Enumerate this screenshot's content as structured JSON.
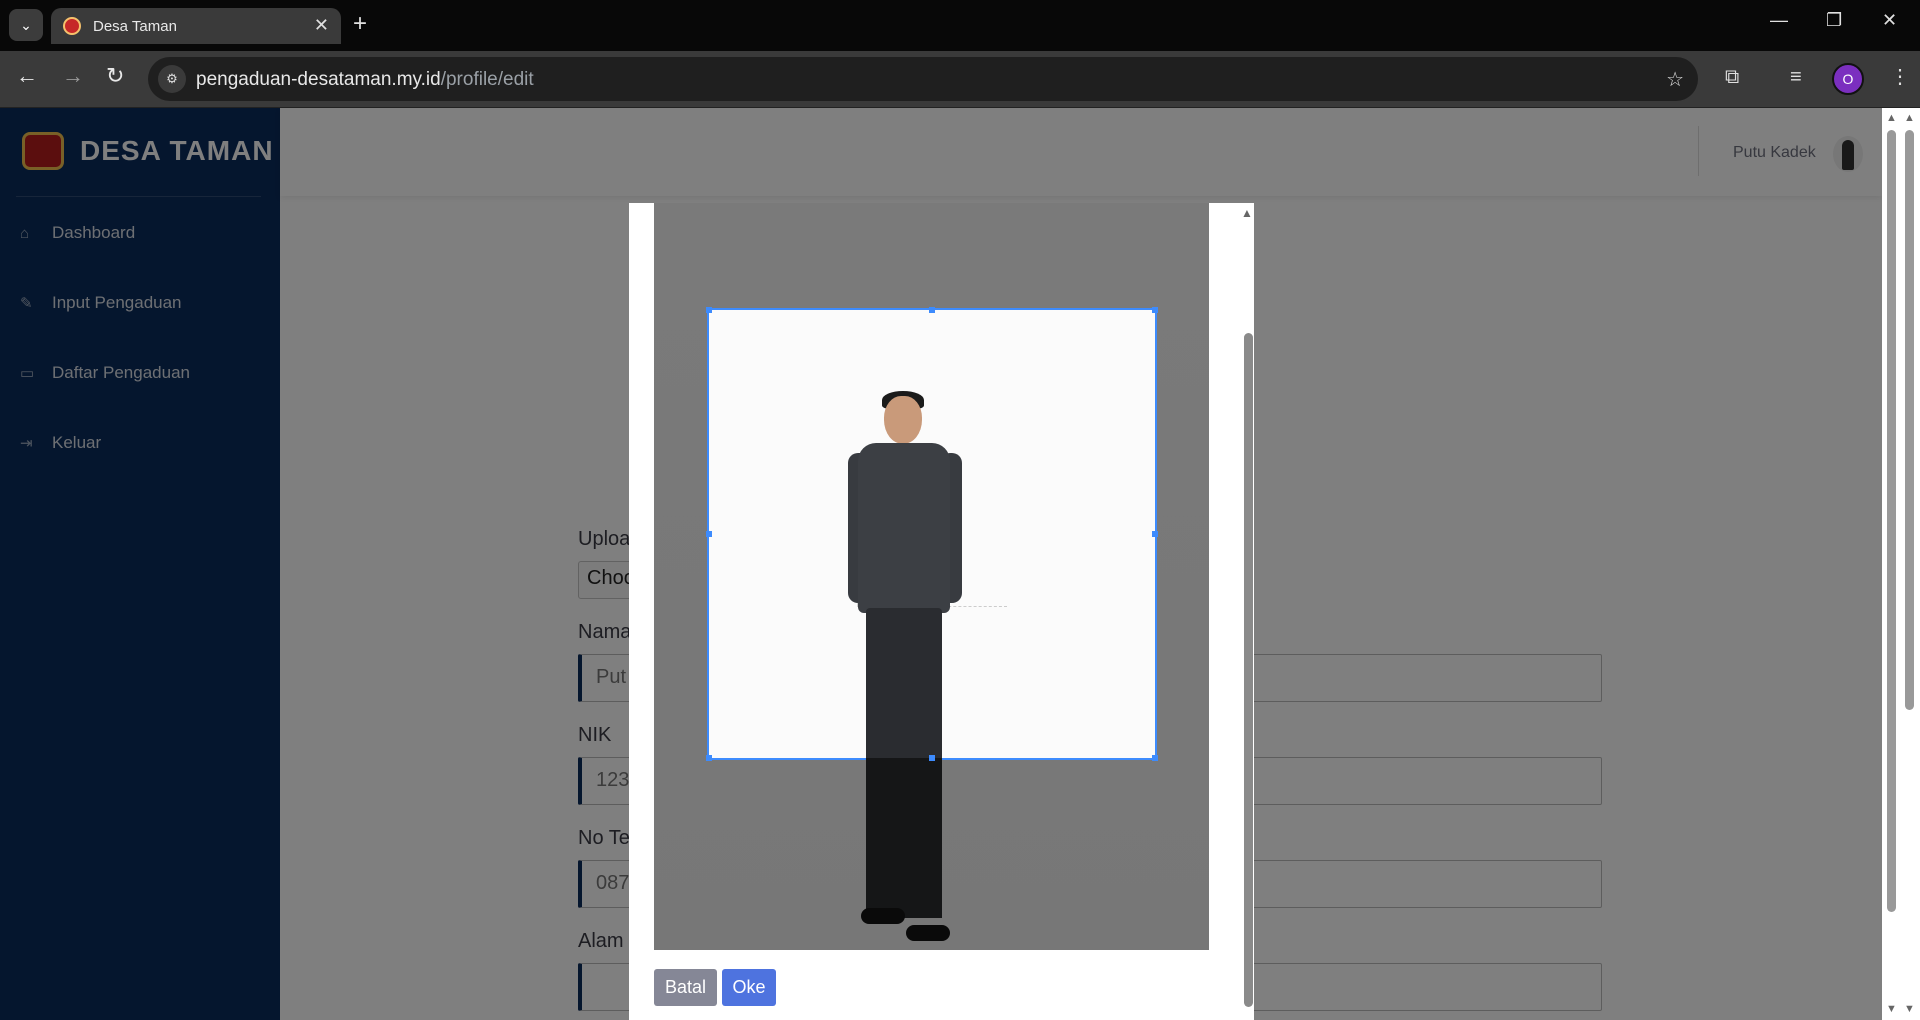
{
  "browser": {
    "tab_title": "Desa Taman",
    "url_domain": "pengaduan-desataman.my.id",
    "url_path": "/profile/edit",
    "profile_initial": "O"
  },
  "sidebar": {
    "brand": "DESA TAMAN",
    "items": [
      {
        "label": "Dashboard",
        "icon": "home-icon"
      },
      {
        "label": "Input Pengaduan",
        "icon": "pencil-icon"
      },
      {
        "label": "Daftar Pengaduan",
        "icon": "inbox-icon"
      },
      {
        "label": "Keluar",
        "icon": "sign-out-icon"
      }
    ]
  },
  "topbar": {
    "user_name": "Putu Kadek"
  },
  "form": {
    "upload_label": "Uploa",
    "file_button": "Choo",
    "nama_label": "Nama",
    "nama_value": "Put",
    "nik_label": "NIK",
    "nik_value": "123",
    "telp_label": "No Te",
    "telp_value": "087",
    "alamat_label": "Alam"
  },
  "modal": {
    "cancel_label": "Batal",
    "ok_label": "Oke",
    "crop_center_glyph": "+"
  },
  "colors": {
    "sidebar": "#0b2c5c",
    "primary": "#4e73df",
    "secondary": "#858796",
    "crop_outline": "#3d8bfd"
  }
}
